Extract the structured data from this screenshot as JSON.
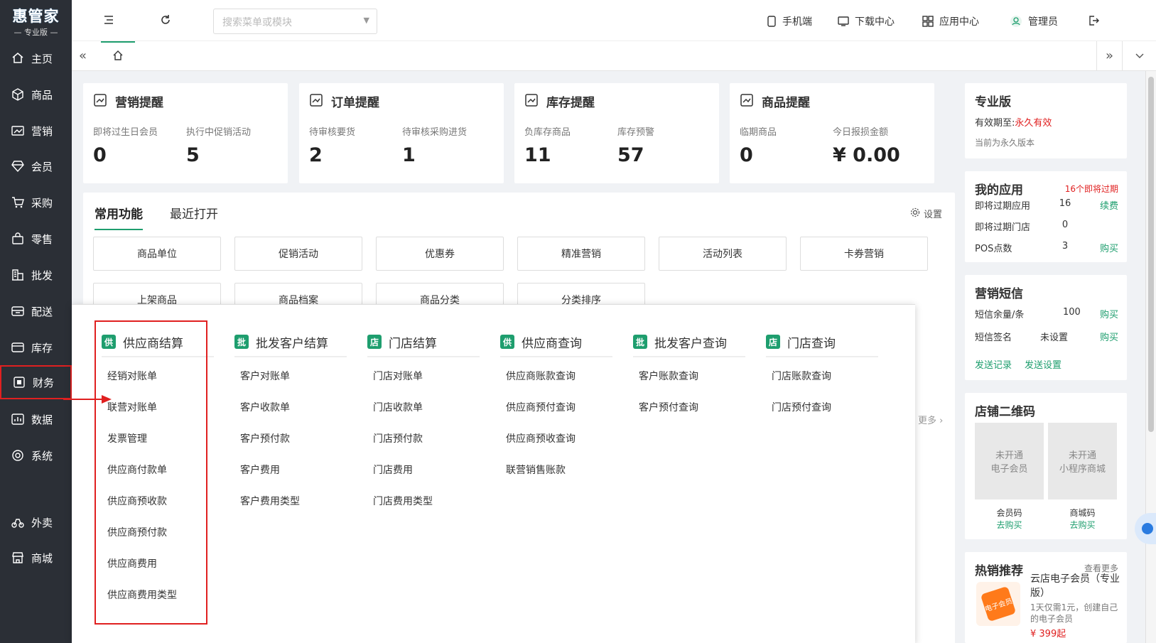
{
  "logo": {
    "title": "惠管家",
    "subtitle": "专业版"
  },
  "sidebar": [
    {
      "label": "主页",
      "icon": "home-icon"
    },
    {
      "label": "商品",
      "icon": "cube-icon"
    },
    {
      "label": "营销",
      "icon": "chart-icon"
    },
    {
      "label": "会员",
      "icon": "diamond-icon"
    },
    {
      "label": "采购",
      "icon": "cart-icon"
    },
    {
      "label": "零售",
      "icon": "bag-icon"
    },
    {
      "label": "批发",
      "icon": "building-icon"
    },
    {
      "label": "配送",
      "icon": "truck-icon"
    },
    {
      "label": "库存",
      "icon": "box-icon"
    },
    {
      "label": "财务",
      "icon": "finance-icon"
    },
    {
      "label": "数据",
      "icon": "data-icon"
    },
    {
      "label": "系统",
      "icon": "settings-icon"
    },
    {
      "label": "外卖",
      "icon": "scooter-icon"
    },
    {
      "label": "商城",
      "icon": "store-icon"
    }
  ],
  "topbar": {
    "search_placeholder": "搜索菜单或模块",
    "mobile": "手机端",
    "download": "下载中心",
    "apps": "应用中心",
    "user": "管理员"
  },
  "stats": [
    {
      "title": "营销提醒",
      "a_label": "即将过生日会员",
      "a_value": "0",
      "b_label": "执行中促销活动",
      "b_value": "5"
    },
    {
      "title": "订单提醒",
      "a_label": "待审核要货",
      "a_value": "2",
      "b_label": "待审核采购进货",
      "b_value": "1"
    },
    {
      "title": "库存提醒",
      "a_label": "负库存商品",
      "a_value": "11",
      "b_label": "库存预警",
      "b_value": "57"
    },
    {
      "title": "商品提醒",
      "a_label": "临期商品",
      "a_value": "0",
      "b_label": "今日报损金额",
      "b_value": "¥ 0.00"
    }
  ],
  "func": {
    "tab1": "常用功能",
    "tab2": "最近打开",
    "settings": "设置",
    "buttons": [
      "商品单位",
      "促销活动",
      "优惠券",
      "精准营销",
      "活动列表",
      "卡券营销"
    ],
    "buttons2": [
      "上架商品",
      "商品档案",
      "商品分类",
      "分类排序"
    ],
    "more": "更多"
  },
  "dropdown": [
    {
      "title": "供应商结算",
      "badge": "供",
      "items": [
        "经销对账单",
        "联营对账单",
        "发票管理",
        "供应商付款单",
        "供应商预收款",
        "供应商预付款",
        "供应商费用",
        "供应商费用类型"
      ]
    },
    {
      "title": "批发客户结算",
      "badge": "批",
      "items": [
        "客户对账单",
        "客户收款单",
        "客户预付款",
        "客户费用",
        "客户费用类型"
      ]
    },
    {
      "title": "门店结算",
      "badge": "店",
      "items": [
        "门店对账单",
        "门店收款单",
        "门店预付款",
        "门店费用",
        "门店费用类型"
      ]
    },
    {
      "title": "供应商查询",
      "badge": "供",
      "items": [
        "供应商账款查询",
        "供应商预付查询",
        "供应商预收查询",
        "联营销售账款"
      ]
    },
    {
      "title": "批发客户查询",
      "badge": "批",
      "items": [
        "客户账款查询",
        "客户预付查询"
      ]
    },
    {
      "title": "门店查询",
      "badge": "店",
      "items": [
        "门店账款查询",
        "门店预付查询"
      ]
    }
  ],
  "right": {
    "pro": {
      "title": "专业版",
      "expire_label": "有效期至:",
      "expire_value": "永久有效",
      "note": "当前为永久版本"
    },
    "apps": {
      "title": "我的应用",
      "alert": "16个即将过期",
      "rows": [
        {
          "label": "即将过期应用",
          "value": "16",
          "action": "续费"
        },
        {
          "label": "即将过期门店",
          "value": "0",
          "action": ""
        },
        {
          "label": "POS点数",
          "value": "3",
          "action": "购买"
        }
      ]
    },
    "sms": {
      "title": "营销短信",
      "r1_label": "短信余量/条",
      "r1_value": "100",
      "r1_action": "购买",
      "r2_label": "短信签名",
      "r2_value": "未设置",
      "r2_action": "购买",
      "link1": "发送记录",
      "link2": "发送设置"
    },
    "qr": {
      "title": "店铺二维码",
      "q1a": "未开通",
      "q1b": "电子会员",
      "q2a": "未开通",
      "q2b": "小程序商城",
      "c1": "会员码",
      "c1b": "去购买",
      "c2": "商城码",
      "c2b": "去购买"
    },
    "hot": {
      "title": "热销推荐",
      "more": "查看更多",
      "name": "云店电子会员（专业版）",
      "desc": "1天仅需1元，创建自己的电子会员",
      "price": "¥ 399起",
      "img_text": "电子会员"
    }
  }
}
